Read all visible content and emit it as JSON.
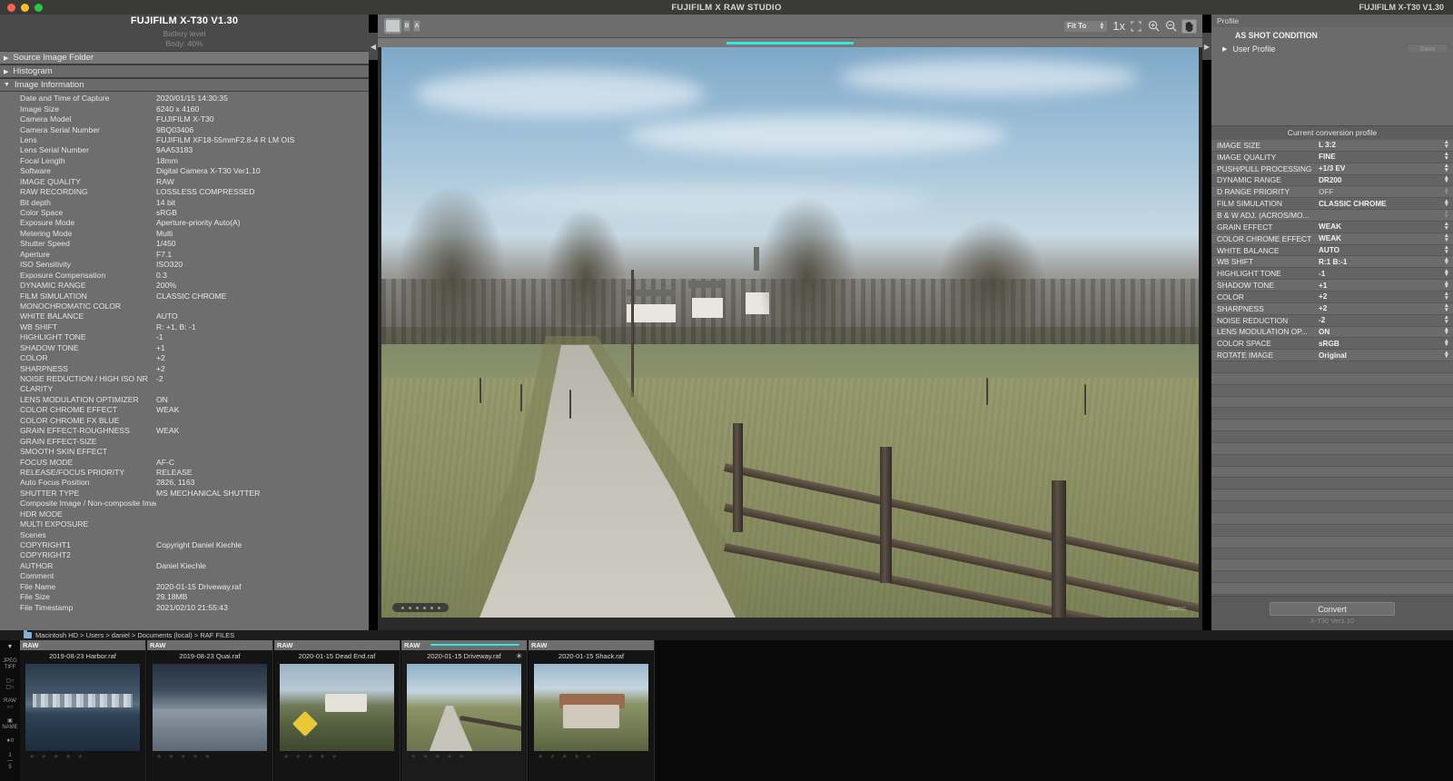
{
  "window": {
    "title": "FUJIFILM X RAW STUDIO",
    "right_label": "FUJIFILM X-T30   V1.30",
    "accent_cyan": "#2fe8e8"
  },
  "left_panel": {
    "camera_title": "FUJIFILM X-T30    V1.30",
    "battery_label": "Battery level",
    "battery_value": "Body: 40%",
    "sections": [
      {
        "label": "Source Image Folder",
        "expanded": false
      },
      {
        "label": "Histogram",
        "expanded": false
      },
      {
        "label": "Image Information",
        "expanded": true
      }
    ],
    "image_information": [
      {
        "key": "Date and Time of Capture",
        "value": "2020/01/15 14:30:35"
      },
      {
        "key": "Image Size",
        "value": "6240 x 4160"
      },
      {
        "key": "Camera Model",
        "value": "FUJIFILM X-T30"
      },
      {
        "key": "Camera Serial Number",
        "value": "9BQ03406"
      },
      {
        "key": "Lens",
        "value": "FUJIFILM XF18-55mmF2.8-4 R LM OIS"
      },
      {
        "key": "Lens Serial Number",
        "value": "9AA53183"
      },
      {
        "key": "Focal Length",
        "value": "18mm"
      },
      {
        "key": "Software",
        "value": "Digital Camera X-T30 Ver1.10"
      },
      {
        "key": "IMAGE QUALITY",
        "value": "RAW"
      },
      {
        "key": "RAW RECORDING",
        "value": "LOSSLESS COMPRESSED"
      },
      {
        "key": "Bit depth",
        "value": "14 bit"
      },
      {
        "key": "Color Space",
        "value": "sRGB"
      },
      {
        "key": "Exposure Mode",
        "value": "Aperture-priority Auto(A)"
      },
      {
        "key": "Metering Mode",
        "value": "Multi"
      },
      {
        "key": "Shutter Speed",
        "value": "1/450"
      },
      {
        "key": "Aperture",
        "value": "F7.1"
      },
      {
        "key": "ISO Sensitivity",
        "value": "ISO320"
      },
      {
        "key": "Exposure Compensation",
        "value": "0.3"
      },
      {
        "key": "DYNAMIC RANGE",
        "value": "200%"
      },
      {
        "key": "FILM SIMULATION",
        "value": "CLASSIC CHROME"
      },
      {
        "key": "MONOCHROMATIC COLOR",
        "value": ""
      },
      {
        "key": "WHITE BALANCE",
        "value": "AUTO"
      },
      {
        "key": "WB SHIFT",
        "value": "R: +1, B: -1"
      },
      {
        "key": "HIGHLIGHT TONE",
        "value": "-1"
      },
      {
        "key": "SHADOW TONE",
        "value": "+1"
      },
      {
        "key": "COLOR",
        "value": "+2"
      },
      {
        "key": "SHARPNESS",
        "value": "+2"
      },
      {
        "key": "NOISE REDUCTION / HIGH ISO NR",
        "value": "-2"
      },
      {
        "key": "CLARITY",
        "value": ""
      },
      {
        "key": "LENS MODULATION OPTIMIZER",
        "value": "ON"
      },
      {
        "key": "COLOR CHROME EFFECT",
        "value": "WEAK"
      },
      {
        "key": "COLOR CHROME FX BLUE",
        "value": ""
      },
      {
        "key": "GRAIN EFFECT-ROUGHNESS",
        "value": "WEAK"
      },
      {
        "key": "GRAIN EFFECT-SIZE",
        "value": ""
      },
      {
        "key": "SMOOTH SKIN EFFECT",
        "value": ""
      },
      {
        "key": "FOCUS MODE",
        "value": "AF-C"
      },
      {
        "key": "RELEASE/FOCUS PRIORITY",
        "value": "RELEASE"
      },
      {
        "key": "Auto Focus Position",
        "value": "2826, 1163"
      },
      {
        "key": "SHUTTER TYPE",
        "value": "MS MECHANICAL SHUTTER"
      },
      {
        "key": "Composite Image / Non-composite Image",
        "value": ""
      },
      {
        "key": "HDR MODE",
        "value": ""
      },
      {
        "key": "MULTI EXPOSURE",
        "value": ""
      },
      {
        "key": "Scenes",
        "value": ""
      },
      {
        "key": "COPYRIGHT1",
        "value": "Copyright Daniel Kiechle"
      },
      {
        "key": "COPYRIGHT2",
        "value": ""
      },
      {
        "key": "AUTHOR",
        "value": "Daniel Kiechle"
      },
      {
        "key": "Comment",
        "value": ""
      },
      {
        "key": "File Name",
        "value": "2020-01-15 Driveway.raf"
      },
      {
        "key": "File Size",
        "value": "29.18MB"
      },
      {
        "key": "File Timestamp",
        "value": "2021/02/10 21:55:43"
      }
    ]
  },
  "viewer": {
    "toolbar": {
      "single_view_icon": "single-image-view-icon",
      "before_label": "B",
      "after_label": "A",
      "fit_to_label": "Fit To",
      "zoom_1x_label": "1x",
      "fit_screen_icon": "fit-to-screen-icon",
      "zoom_in_icon": "zoom-in-icon",
      "zoom_out_icon": "zoom-out-icon",
      "hand_icon": "hand-pan-icon"
    },
    "page_dots": 6,
    "watermark": "Stamp"
  },
  "right_panel": {
    "profile_header": "Profile",
    "as_shot_condition": "AS SHOT CONDITION",
    "user_profile": "User Profile",
    "save_label": "Save",
    "current_conversion_profile": "Current conversion profile",
    "settings": [
      {
        "key": "IMAGE SIZE",
        "value": "L 3:2",
        "enabled": true
      },
      {
        "key": "IMAGE QUALITY",
        "value": "FINE",
        "enabled": true
      },
      {
        "key": "PUSH/PULL PROCESSING",
        "value": "+1/3 EV",
        "enabled": true
      },
      {
        "key": "DYNAMIC RANGE",
        "value": "DR200",
        "enabled": true
      },
      {
        "key": "D RANGE PRIORITY",
        "value": "OFF",
        "enabled": false
      },
      {
        "key": "FILM SIMULATION",
        "value": "CLASSIC CHROME",
        "enabled": true
      },
      {
        "key": "B & W ADJ. (ACROS/MO...",
        "value": "",
        "enabled": false
      },
      {
        "key": "GRAIN EFFECT",
        "value": "WEAK",
        "enabled": true
      },
      {
        "key": "COLOR CHROME EFFECT",
        "value": "WEAK",
        "enabled": true
      },
      {
        "key": "WHITE BALANCE",
        "value": "AUTO",
        "enabled": true
      },
      {
        "key": "WB SHIFT",
        "value": "R:1 B:-1",
        "enabled": true
      },
      {
        "key": "HIGHLIGHT TONE",
        "value": "-1",
        "enabled": true
      },
      {
        "key": "SHADOW TONE",
        "value": "+1",
        "enabled": true
      },
      {
        "key": "COLOR",
        "value": "+2",
        "enabled": true
      },
      {
        "key": "SHARPNESS",
        "value": "+2",
        "enabled": true
      },
      {
        "key": "NOISE REDUCTION",
        "value": "-2",
        "enabled": true
      },
      {
        "key": "LENS MODULATION OP...",
        "value": "ON",
        "enabled": true
      },
      {
        "key": "COLOR SPACE",
        "value": "sRGB",
        "enabled": true
      },
      {
        "key": "ROTATE IMAGE",
        "value": "Original",
        "enabled": true
      }
    ],
    "convert_label": "Convert",
    "version_label": "X-T30 Ver1.10"
  },
  "filmstrip": {
    "breadcrumb": "Macintosh HD > Users > daniel > Documents (local) > RAF FILES",
    "side_tools": [
      {
        "name": "caret-down-icon",
        "label": "▾"
      },
      {
        "name": "jpeg-tiff-filter-icon",
        "label": "JPEG\nTIFF"
      },
      {
        "name": "camera-filter-icon",
        "label": "camera"
      },
      {
        "name": "raw-filter-icon",
        "label": "RAW"
      },
      {
        "name": "name-sort-icon",
        "label": "NAME"
      },
      {
        "name": "star-rating-filter-icon",
        "label": "★ 0"
      },
      {
        "name": "fraction-icon",
        "label": "1/5"
      }
    ],
    "thumbnails": [
      {
        "format": "RAW",
        "name": "2019-08-23 Harbor.raf",
        "selected": false,
        "edited": false,
        "scene": "harbor",
        "stars": 5
      },
      {
        "format": "RAW",
        "name": "2019-08-23 Quai.raf",
        "selected": false,
        "edited": false,
        "scene": "quai",
        "stars": 5
      },
      {
        "format": "RAW",
        "name": "2020-01-15 Dead End.raf",
        "selected": false,
        "edited": false,
        "scene": "deadend",
        "stars": 5
      },
      {
        "format": "RAW",
        "name": "2020-01-15 Driveway.raf",
        "selected": true,
        "edited": true,
        "scene": "driveway",
        "stars": 5
      },
      {
        "format": "RAW",
        "name": "2020-01-15 Shack.raf",
        "selected": false,
        "edited": false,
        "scene": "shack",
        "stars": 5
      }
    ]
  }
}
